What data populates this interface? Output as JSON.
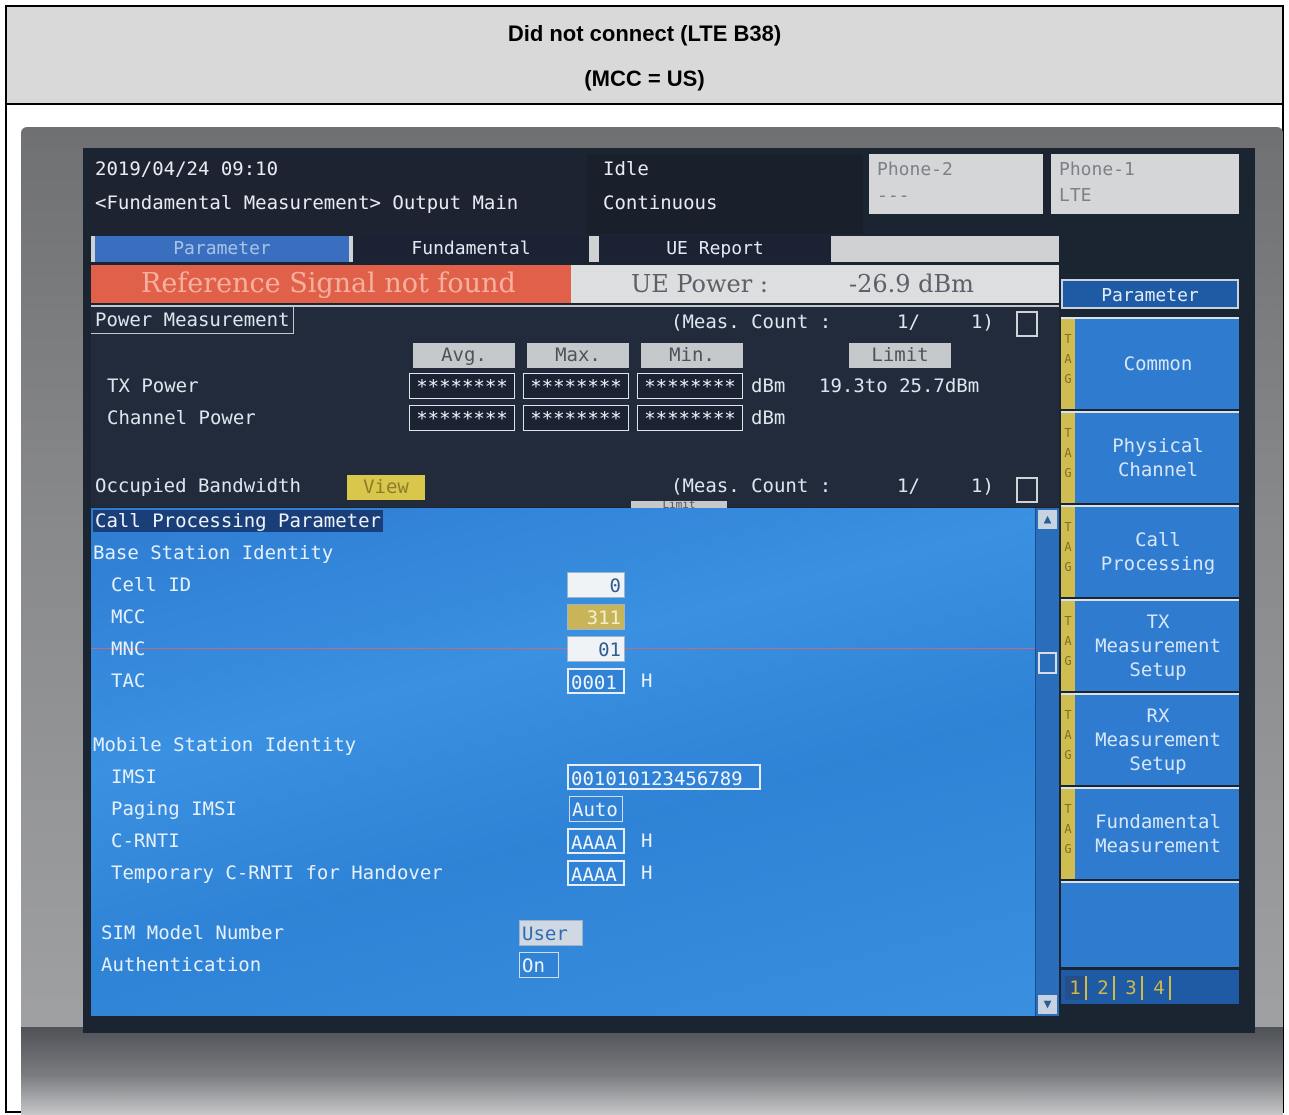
{
  "caption": {
    "line1": "Did not connect (LTE B38)",
    "line2": "(MCC = US)"
  },
  "header": {
    "datetime": "2019/04/24 09:10",
    "screen_title": "<Fundamental Measurement> Output Main",
    "state": "Idle",
    "mode": "Continuous",
    "phone2": {
      "label": "Phone-2",
      "value": "---"
    },
    "phone1": {
      "label": "Phone-1",
      "value": "LTE"
    }
  },
  "tabs": [
    "Parameter",
    "Fundamental",
    "UE Report"
  ],
  "status": {
    "alert": "Reference Signal not found",
    "ue_power_label": "UE Power :",
    "ue_power_value": "-26.9 dBm"
  },
  "power_measurement": {
    "title": "Power Measurement",
    "meas_count_label": "(Meas. Count :",
    "meas_count_value": "1/",
    "meas_count_total": "1)",
    "col_avg": "Avg.",
    "col_max": "Max.",
    "col_min": "Min.",
    "col_limit": "Limit",
    "rows": [
      {
        "label": "TX Power",
        "avg": "********",
        "max": "********",
        "min": "********",
        "unit": "dBm",
        "limit": "19.3to 25.7dBm"
      },
      {
        "label": "Channel Power",
        "avg": "********",
        "max": "********",
        "min": "********",
        "unit": "dBm",
        "limit": ""
      }
    ]
  },
  "occupied_bandwidth": {
    "title": "Occupied Bandwidth",
    "view_label": "View",
    "meas_count_label": "(Meas. Count :",
    "meas_count_value": "1/",
    "meas_count_total": "1)",
    "limit_label": "Limit"
  },
  "call_processing": {
    "title": "Call Processing Parameter",
    "base_station_title": "Base Station Identity",
    "cell_id_label": "Cell ID",
    "cell_id_value": "0",
    "mcc_label": "MCC",
    "mcc_value": "311",
    "mnc_label": "MNC",
    "mnc_value": "01",
    "tac_label": "TAC",
    "tac_value": "0001",
    "tac_unit": "H",
    "mobile_station_title": "Mobile Station Identity",
    "imsi_label": "IMSI",
    "imsi_value": "001010123456789",
    "paging_imsi_label": "Paging IMSI",
    "paging_imsi_value": "Auto",
    "crnti_label": "C-RNTI",
    "crnti_value": "AAAA",
    "crnti_unit": "H",
    "temp_crnti_label": "Temporary C-RNTI for Handover",
    "temp_crnti_value": "AAAA",
    "temp_crnti_unit": "H",
    "sim_model_label": "SIM Model Number",
    "sim_model_value": "User",
    "auth_label": "Authentication",
    "auth_value": "On"
  },
  "side_menu": {
    "title": "Parameter",
    "tag_letters": "TAG",
    "items": [
      {
        "line1": "Common",
        "line2": "",
        "line3": ""
      },
      {
        "line1": "Physical",
        "line2": "Channel",
        "line3": ""
      },
      {
        "line1": "Call",
        "line2": "Processing",
        "line3": ""
      },
      {
        "line1": "TX",
        "line2": "Measurement",
        "line3": "Setup"
      },
      {
        "line1": "RX",
        "line2": "Measurement",
        "line3": "Setup"
      },
      {
        "line1": "Fundamental",
        "line2": "Measurement",
        "line3": ""
      }
    ],
    "pages": [
      "1",
      "2",
      "3",
      "4"
    ],
    "current_page": "1"
  }
}
